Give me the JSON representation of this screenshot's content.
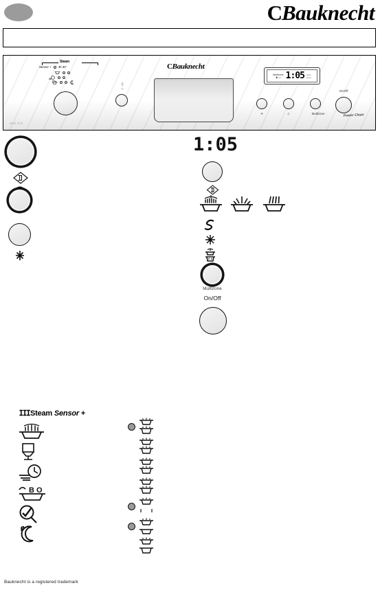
{
  "header": {
    "brand_c": "C",
    "brand_name": "Bauknecht",
    "badge": "ellipse-badge"
  },
  "title_box": {
    "text": ""
  },
  "panel": {
    "brand_c": "C",
    "brand_name": "Bauknecht",
    "model_code": "dwh b10",
    "power_clean_label": "Power Clean",
    "steam_group_label": "Steam",
    "program_rows": [
      {
        "left_label": "Sensor +",
        "right_label": "4h 30'"
      },
      {
        "left_label": "",
        "right_label": ""
      },
      {
        "left_label": "",
        "right_label": ""
      },
      {
        "left_label": "",
        "right_label": ""
      }
    ],
    "lcd": {
      "value": "1:05",
      "left_mini": "Multizone",
      "right_mini": "h"
    },
    "buttons": [
      {
        "name": "start-button",
        "label": ""
      },
      {
        "name": "delay-button",
        "label": ""
      },
      {
        "name": "multizone-button",
        "label": "Multizone"
      },
      {
        "name": "onoff-button",
        "label": "On/Off"
      }
    ]
  },
  "diagram": {
    "program_knob": "program-selector-knob",
    "start_icon": "start-pause-icon",
    "tablet_icon": "tablet-icon",
    "option_button": "option-button",
    "salt_icon": "salt-refill-icon",
    "display_value": "1:05",
    "delay_button": "delay-start-button",
    "delay_icon": "delay-start-icon",
    "phase_icons": [
      "wash-phase-icon",
      "rinse-phase-icon",
      "dry-phase-icon"
    ],
    "status_icons": [
      "sanitize-icon",
      "salt-low-icon",
      "rinse-aid-low-icon"
    ],
    "multizone_button": "multizone-button",
    "multizone_label": "Multizone",
    "onoff_label": "On/Off",
    "onoff_button": "onoff-button"
  },
  "legend": {
    "title_prefix": "Steam",
    "title_italic": "Sensor",
    "title_suffix": "+",
    "left_items": [
      {
        "name": "steam-sensor-plus-icon",
        "label": ""
      },
      {
        "name": "spray-basket-icon",
        "label": ""
      },
      {
        "name": "glass-icon",
        "label": ""
      },
      {
        "name": "rapid-clock-icon",
        "label": ""
      },
      {
        "name": "eco-basket-icon",
        "label": "B O"
      },
      {
        "name": "prewash-icon",
        "label": ""
      },
      {
        "name": "night-icon",
        "label": ""
      }
    ],
    "right_items": [
      {
        "dot": true,
        "icons": 2,
        "label": ""
      },
      {
        "dot": false,
        "icons": 2,
        "label": ""
      },
      {
        "dot": false,
        "icons": 2,
        "label": ""
      },
      {
        "dot": false,
        "icons": 2,
        "label": ""
      },
      {
        "dot": true,
        "icons": 2,
        "label": ""
      },
      {
        "dot": true,
        "icons": 2,
        "label": ""
      },
      {
        "dot": false,
        "icons": 2,
        "label": ""
      }
    ]
  },
  "footer": {
    "text": "Bauknecht is a registered trademark"
  }
}
